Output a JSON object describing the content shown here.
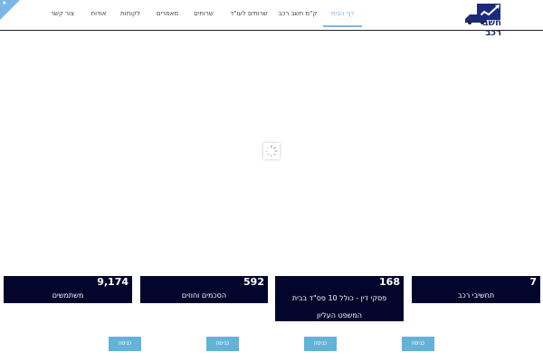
{
  "header": {
    "logo_text": "חשב רכב",
    "nav": [
      {
        "label": "דף הבית",
        "active": true
      },
      {
        "label": "ק\"מ חשב רכב",
        "active": false
      },
      {
        "label": "שרותים לעו\"ד",
        "active": false
      },
      {
        "label": "שרותים",
        "active": false
      },
      {
        "label": "מאמרים",
        "active": false
      },
      {
        "label": "לקוחות",
        "active": false
      },
      {
        "label": "אודות",
        "active": false
      },
      {
        "label": "צור קשר",
        "active": false
      }
    ]
  },
  "stats": [
    {
      "value": "7",
      "label": "תחשיבי רכב"
    },
    {
      "value": "168",
      "label": "פסקי דין - כולל 10 פס\"ד בבית המשפט העליון"
    },
    {
      "value": "592",
      "label": "הסכמים וחוזים"
    },
    {
      "value": "9,174",
      "label": "משתמשים"
    }
  ],
  "buttons": [
    {
      "label": "כניסה"
    },
    {
      "label": "כניסה"
    },
    {
      "label": "כניסה"
    },
    {
      "label": "כניסה"
    }
  ],
  "colors": {
    "accent": "#7db6e6",
    "card_bg": "#04052c",
    "button_bg": "#63b3d8",
    "brand": "#1b2b7a"
  }
}
